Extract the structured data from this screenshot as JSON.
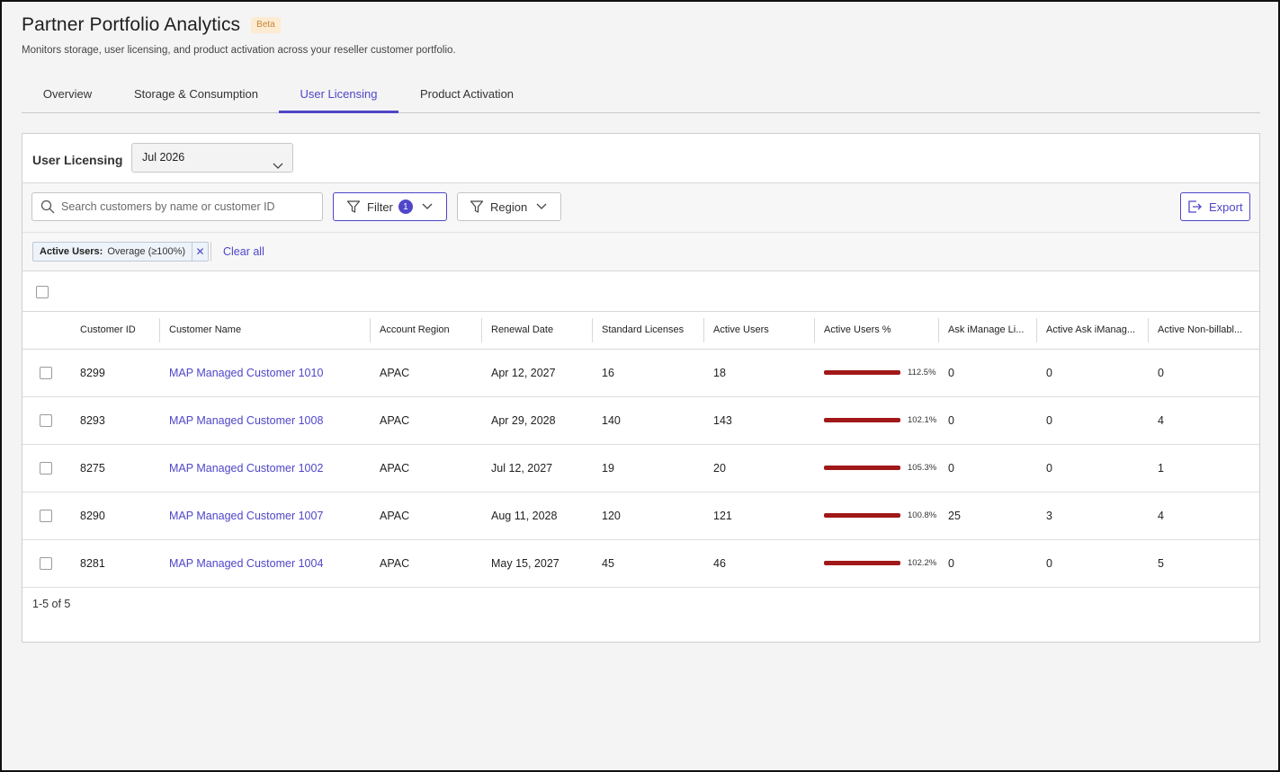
{
  "app": {
    "title": "Partner Portfolio Analytics",
    "badge": "Beta",
    "subtitle": "Monitors storage, user licensing, and product activation across your reseller customer portfolio."
  },
  "tabs": [
    {
      "label": "Overview",
      "active": false
    },
    {
      "label": "Storage & Consumption",
      "active": false
    },
    {
      "label": "User Licensing",
      "active": true
    },
    {
      "label": "Product Activation",
      "active": false
    }
  ],
  "panel": {
    "title": "User Licensing",
    "month_selected": "Jul 2026"
  },
  "toolbar": {
    "search_placeholder": "Search customers by name or customer ID",
    "filter_label": "Filter",
    "filter_count": "1",
    "region_label": "Region",
    "export_label": "Export"
  },
  "active_filter": {
    "name": "Active Users:",
    "value": "Overage (≥100%)",
    "clear_all": "Clear all"
  },
  "table": {
    "columns": [
      "Customer ID",
      "Customer Name",
      "Account Region",
      "Renewal Date",
      "Standard Licenses",
      "Active Users",
      "Active Users %",
      "Ask iManage Li...",
      "Active Ask iManag...",
      "Active Non-billabl..."
    ],
    "rows": [
      {
        "id": "8299",
        "name": "MAP Managed Customer 1010",
        "region": "APAC",
        "renewal": "Apr 12, 2027",
        "standard": "16",
        "active": "18",
        "pct": "112.5%",
        "ask": "0",
        "active_ask": "0",
        "non_billable": "0"
      },
      {
        "id": "8293",
        "name": "MAP Managed Customer 1008",
        "region": "APAC",
        "renewal": "Apr 29, 2028",
        "standard": "140",
        "active": "143",
        "pct": "102.1%",
        "ask": "0",
        "active_ask": "0",
        "non_billable": "4"
      },
      {
        "id": "8275",
        "name": "MAP Managed Customer 1002",
        "region": "APAC",
        "renewal": "Jul 12, 2027",
        "standard": "19",
        "active": "20",
        "pct": "105.3%",
        "ask": "0",
        "active_ask": "0",
        "non_billable": "1"
      },
      {
        "id": "8290",
        "name": "MAP Managed Customer 1007",
        "region": "APAC",
        "renewal": "Aug 11, 2028",
        "standard": "120",
        "active": "121",
        "pct": "100.8%",
        "ask": "25",
        "active_ask": "3",
        "non_billable": "4"
      },
      {
        "id": "8281",
        "name": "MAP Managed Customer 1004",
        "region": "APAC",
        "renewal": "May 15, 2027",
        "standard": "45",
        "active": "46",
        "pct": "102.2%",
        "ask": "0",
        "active_ask": "0",
        "non_billable": "5"
      }
    ]
  },
  "pager": "1-5 of 5",
  "colors": {
    "accent": "#4f46c8",
    "overage_bar": "#a01818",
    "beta_bg": "#fdebd2",
    "beta_text": "#c4863a"
  }
}
